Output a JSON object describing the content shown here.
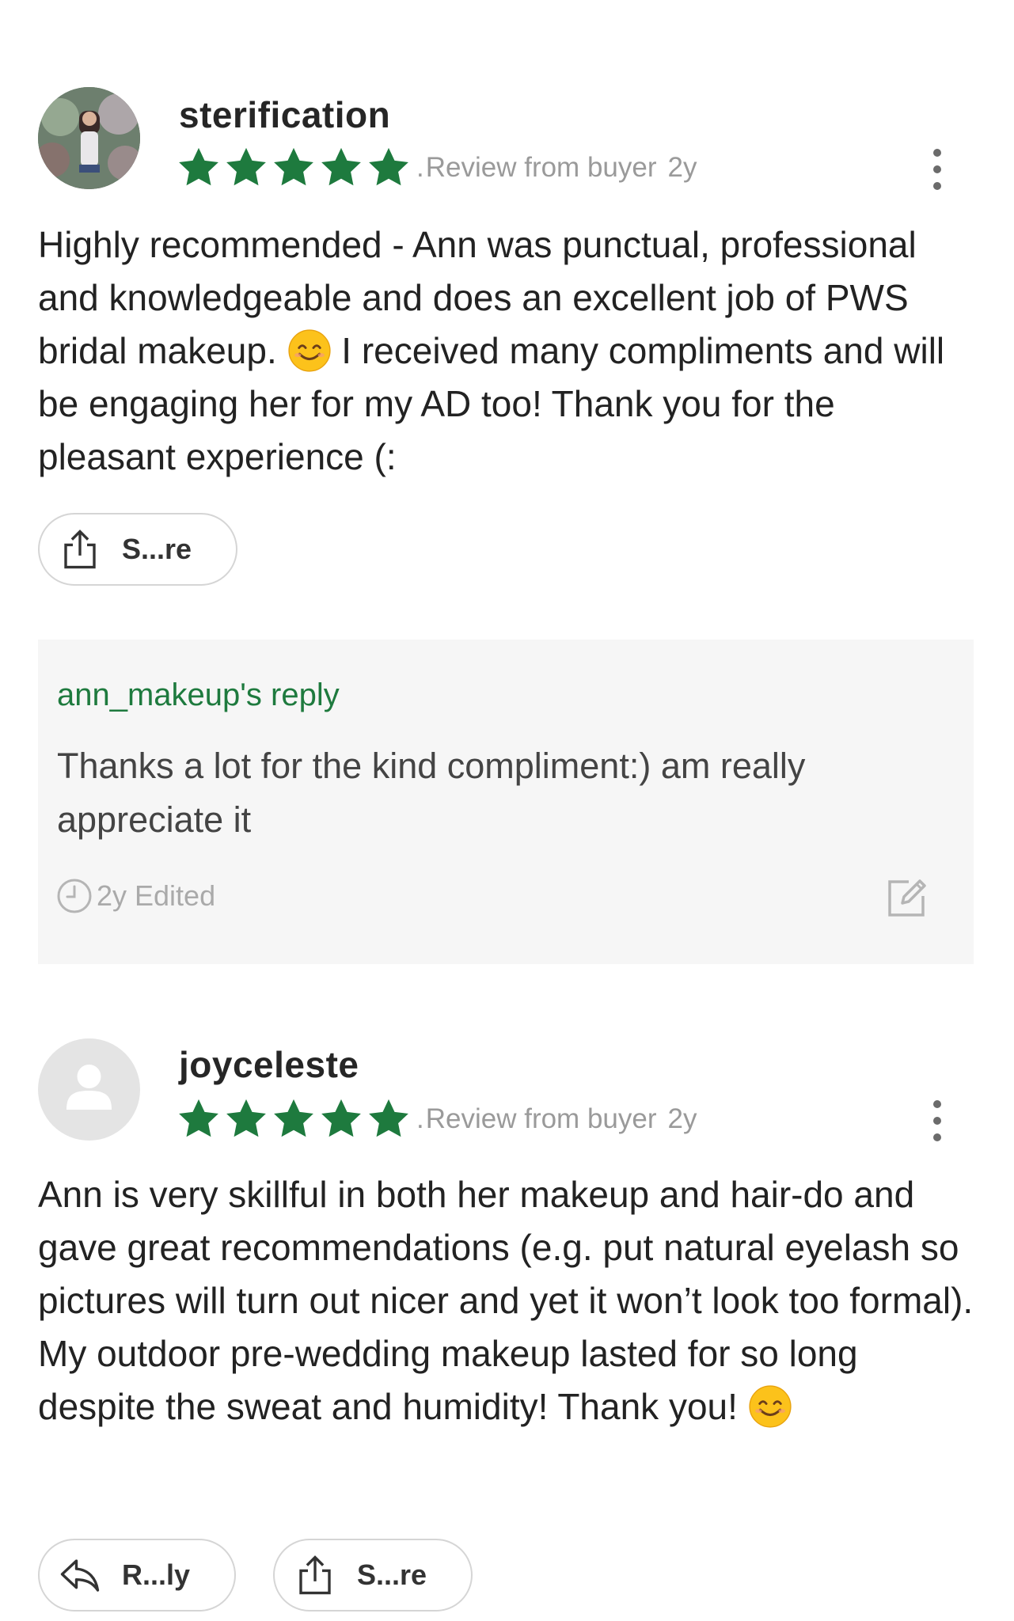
{
  "reviews": [
    {
      "username": "sterification",
      "rating": 5,
      "source": "Review from buyer",
      "age": "2y",
      "body_parts": [
        "Highly recommended - Ann was punctual, professional and knowledgeable and does an excellent job of PWS bridal makeup. ",
        " I received many compliments and will be engaging her for my AD too! Thank you for the pleasant experience (:"
      ],
      "share_label": "S...re",
      "reply": {
        "author": "ann_makeup's reply",
        "text": "Thanks a lot for the kind compliment:) am really appreciate it",
        "time": "2y Edited"
      }
    },
    {
      "username": "joyceleste",
      "rating": 5,
      "source": "Review from buyer",
      "age": "2y",
      "body_parts": [
        "Ann is very skillful in both her makeup and hair-do and gave great recommendations (e.g. put natural eyelash so pictures will turn out nicer and yet it won’t look too formal). My outdoor pre-wedding makeup lasted for so long despite the sweat and humidity! Thank you! "
      ],
      "reply_label": "R...ly",
      "share_label": "S...re"
    }
  ],
  "meta_separator": ".",
  "colors": {
    "star": "#1e7a3e",
    "reply_author": "#1e7a3e",
    "reply_bg": "#f6f6f6",
    "meta": "#9a9a9a"
  },
  "icons": {
    "star": "star-icon",
    "more": "more-vertical-icon",
    "share": "share-icon",
    "reply": "reply-arrow-icon",
    "clock": "clock-icon",
    "edit": "edit-icon",
    "emoji": "smiling-face-emoji"
  }
}
